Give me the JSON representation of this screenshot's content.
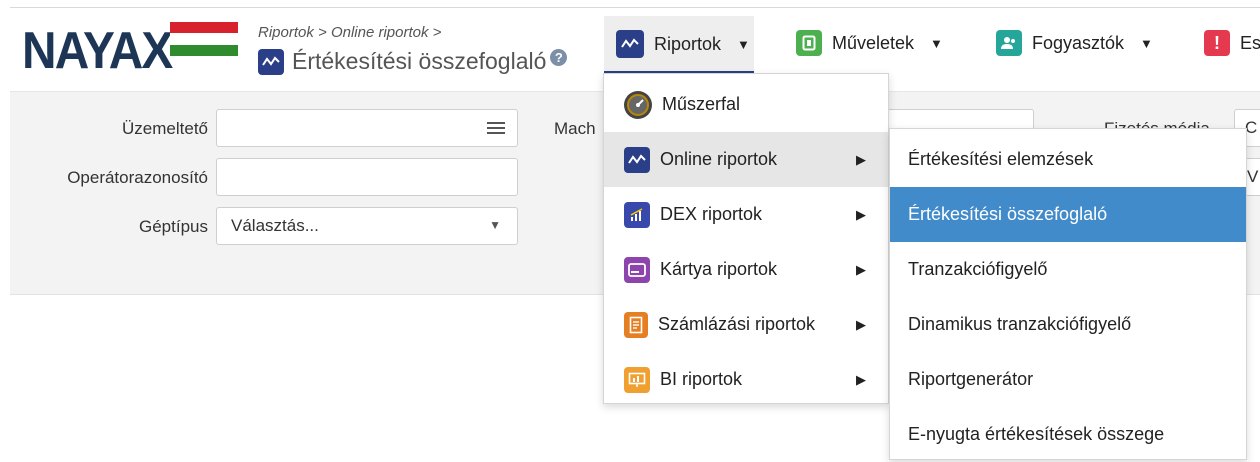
{
  "logo": {
    "text": "NAYAX",
    "flag_colors": [
      "#d7222d",
      "#ffffff",
      "#2e8b2e"
    ]
  },
  "breadcrumb": "Riportok > Online riportok >",
  "page_title": "Értékesítési összefoglaló",
  "help": "?",
  "nav": {
    "riportok": "Riportok",
    "muveletek": "Műveletek",
    "fogyasztok": "Fogyasztók",
    "esemenyek": "Es"
  },
  "filters": {
    "uzemelteto_label": "Üzemeltető",
    "operator_label": "Operátorazonosító",
    "geptipus_label": "Géptípus",
    "geptipus_value": "Választás...",
    "machine_label": "Mach",
    "fizetes_label": "Fizetés módja",
    "fizetes_value_1": "C",
    "fizetes_value_2": "V"
  },
  "menu": [
    {
      "label": "Műszerfal",
      "icon": "dashboard-icon",
      "has_sub": false
    },
    {
      "label": "Online riportok",
      "icon": "online-reports-icon",
      "has_sub": true
    },
    {
      "label": "DEX riportok",
      "icon": "dex-reports-icon",
      "has_sub": true
    },
    {
      "label": "Kártya riportok",
      "icon": "card-reports-icon",
      "has_sub": true
    },
    {
      "label": "Számlázási riportok",
      "icon": "billing-reports-icon",
      "has_sub": true
    },
    {
      "label": "BI riportok",
      "icon": "bi-reports-icon",
      "has_sub": true
    }
  ],
  "submenu": [
    "Értékesítési elemzések",
    "Értékesítési összefoglaló",
    "Tranzakciófigyelő",
    "Dinamikus tranzakciófigyelő",
    "Riportgenerátor",
    "E-nyugta értékesítések összege"
  ],
  "colors": {
    "brand": "#1e3656",
    "menu_active": "#e6e6e6",
    "submenu_active": "#428bca",
    "reports_icon": "#2b3e88",
    "operations_icon": "#4caf50",
    "consumers_icon": "#26a69a",
    "events_icon": "#e53950"
  }
}
